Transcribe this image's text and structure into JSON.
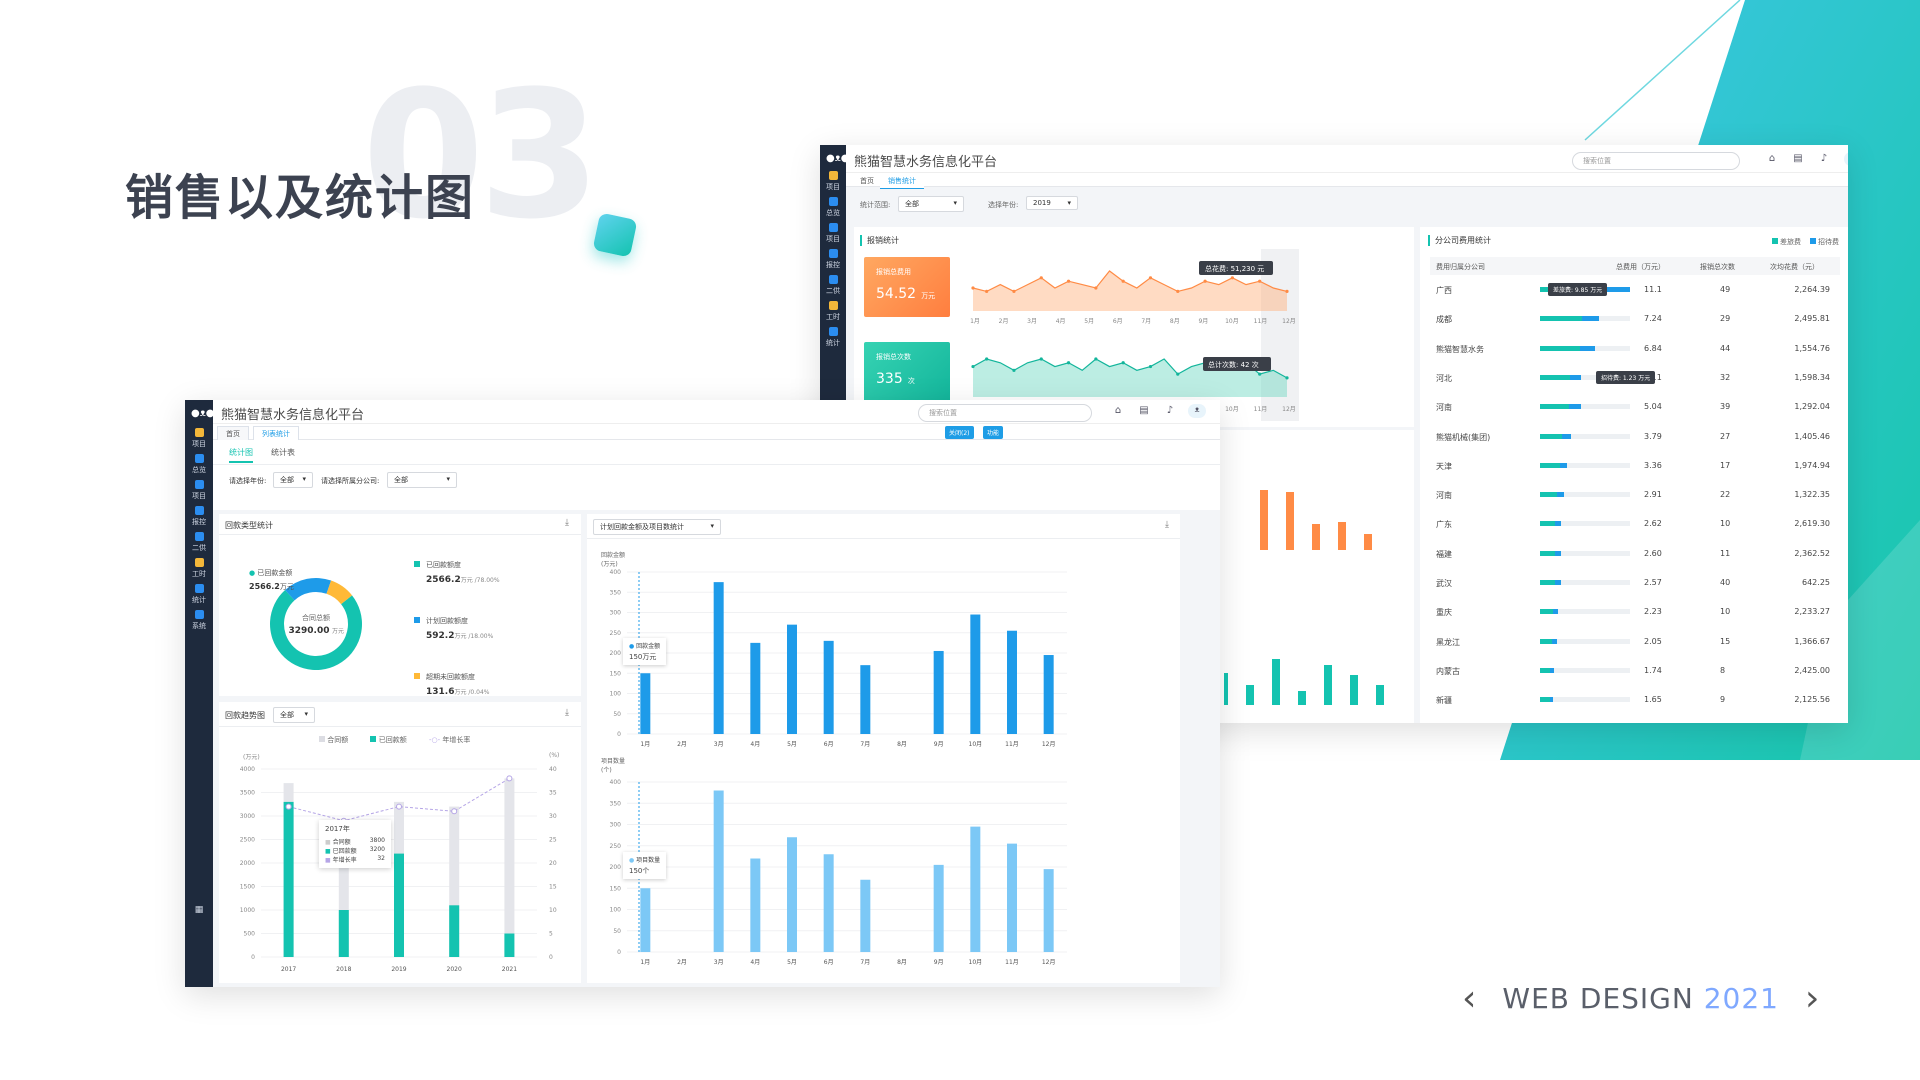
{
  "slide": {
    "title": "销售以及统计图",
    "number": "03",
    "footer_label": "WEB DESIGN",
    "footer_year": "2021",
    "prev_icon": "chevron-left-icon",
    "next_icon": "chevron-right-icon",
    "accent": "#14c3b0"
  },
  "back_window": {
    "app_title": "熊猫智慧水务信息化平台",
    "search_placeholder": "搜索位置",
    "tabs": [
      "首页",
      "销售统计"
    ],
    "filter": {
      "range_label": "统计范围:",
      "range_value": "全部",
      "year_label": "选择年份:",
      "year_value": "2019"
    },
    "sidebar": [
      "项目",
      "总览",
      "项目",
      "报控",
      "二供",
      "工时",
      "统计"
    ],
    "report": {
      "title": "报销统计",
      "cost_card": {
        "label": "报销总费用",
        "value": "54.52",
        "unit": "万元"
      },
      "count_card": {
        "label": "报销总次数",
        "value": "335",
        "unit": "次"
      },
      "cost_tooltip": "总花费: 51,230 元",
      "count_tooltip": "总计次数: 42 次",
      "months": [
        "1月",
        "2月",
        "3月",
        "4月",
        "5月",
        "6月",
        "7月",
        "8月",
        "9月",
        "10月",
        "11月",
        "12月"
      ]
    },
    "branch": {
      "title": "分公司费用统计",
      "legend_a": "差旅费",
      "legend_b": "招待费",
      "columns": [
        "费用归属分公司",
        "总费用（万元）",
        "报销总次数",
        "次均花费（元）"
      ],
      "tooltip_a": "差旅费: 9.85 万元",
      "tooltip_b": "招待费: 1.23 万元",
      "rows": [
        {
          "name": "广西",
          "total": "11.1",
          "count": "49",
          "avg": "2,264.39"
        },
        {
          "name": "成都",
          "total": "7.24",
          "count": "29",
          "avg": "2,495.81"
        },
        {
          "name": "熊猫智慧水务",
          "total": "6.84",
          "count": "44",
          "avg": "1,554.76"
        },
        {
          "name": "河北",
          "total": "5.11",
          "count": "32",
          "avg": "1,598.34"
        },
        {
          "name": "河南",
          "total": "5.04",
          "count": "39",
          "avg": "1,292.04"
        },
        {
          "name": "熊猫机械(集团)",
          "total": "3.79",
          "count": "27",
          "avg": "1,405.46"
        },
        {
          "name": "天津",
          "total": "3.36",
          "count": "17",
          "avg": "1,974.94"
        },
        {
          "name": "河南",
          "total": "2.91",
          "count": "22",
          "avg": "1,322.35"
        },
        {
          "name": "广东",
          "total": "2.62",
          "count": "10",
          "avg": "2,619.30"
        },
        {
          "name": "福建",
          "total": "2.60",
          "count": "11",
          "avg": "2,362.52"
        },
        {
          "name": "武汉",
          "total": "2.57",
          "count": "40",
          "avg": "642.25"
        },
        {
          "name": "重庆",
          "total": "2.23",
          "count": "10",
          "avg": "2,233.27"
        },
        {
          "name": "黑龙江",
          "total": "2.05",
          "count": "15",
          "avg": "1,366.67"
        },
        {
          "name": "内蒙古",
          "total": "1.74",
          "count": "8",
          "avg": "2,425.00"
        },
        {
          "name": "新疆",
          "total": "1.65",
          "count": "9",
          "avg": "2,125.56"
        }
      ]
    }
  },
  "front_window": {
    "app_title": "熊猫智慧水务信息化平台",
    "search_placeholder": "搜索位置",
    "tabs": [
      "首页",
      "列表统计"
    ],
    "buttons": {
      "close": "关闭(2)",
      "more": "功能"
    },
    "sidebar": [
      "项目",
      "总览",
      "项目",
      "报控",
      "二供",
      "工时",
      "统计",
      "系统"
    ],
    "view_tabs": [
      "统计图",
      "统计表"
    ],
    "filters": {
      "year_label": "请选择年份:",
      "year_value": "全部",
      "company_label": "请选择所属分公司:",
      "company_value": "全部"
    },
    "donut": {
      "title": "回款类型统计",
      "center_label": "合同总额",
      "center_value": "3290.00",
      "center_unit": "万元",
      "callout_label": "已回款金额",
      "callout_value": "2566.2",
      "callout_unit": "万元",
      "legend": [
        {
          "label": "已回款额度",
          "value": "2566.2",
          "suffix": "万元 /78.00%",
          "color": "#14c3b0"
        },
        {
          "label": "计划回款额度",
          "value": "592.2",
          "suffix": "万元 /18.00%",
          "color": "#1e9be9"
        },
        {
          "label": "超期未回款额度",
          "value": "131.6",
          "suffix": "万元 /0.04%",
          "color": "#ffb937"
        }
      ]
    },
    "trend": {
      "title": "回款趋势图",
      "select": "全部",
      "legend": [
        "合同额",
        "已回款额",
        "年增长率"
      ],
      "yleft_unit": "(万元)",
      "yright_unit": "(%)",
      "tooltip": {
        "year": "2017年",
        "rows": [
          [
            "合同额",
            "3800"
          ],
          [
            "已回款额",
            "3200"
          ],
          [
            "年增长率",
            "32"
          ]
        ]
      }
    },
    "plan": {
      "select": "计划回款金额及项目数统计",
      "top_unit": "回款金额\n(万元)",
      "top_tooltip_label": "回款金额",
      "top_tooltip_value": "150万元",
      "bottom_unit": "项目数量\n(个)",
      "bottom_tooltip_label": "项目数量",
      "bottom_tooltip_value": "150个"
    }
  },
  "chart_data": [
    {
      "type": "area",
      "title": "报销总费用",
      "categories": [
        "1月",
        "2月",
        "3月",
        "4月",
        "5月",
        "6月",
        "7月",
        "8月",
        "9月",
        "10月",
        "11月",
        "12月"
      ],
      "values": [
        10,
        9,
        11,
        9,
        11,
        13,
        10,
        12,
        11,
        10,
        15,
        12,
        10,
        13,
        11,
        9,
        10,
        12,
        11,
        13,
        11,
        12,
        10,
        9
      ]
    },
    {
      "type": "area",
      "title": "报销总次数",
      "categories": [
        "1月",
        "2月",
        "3月",
        "4月",
        "5月",
        "6月",
        "7月",
        "8月",
        "9月",
        "10月",
        "11月",
        "12月"
      ],
      "values": [
        14,
        16,
        15,
        13,
        15,
        16,
        14,
        15,
        13,
        16,
        14,
        15,
        13,
        14,
        16,
        12,
        14,
        15,
        13,
        14,
        15,
        12,
        13,
        11
      ]
    },
    {
      "type": "bar",
      "title": "回款金额",
      "categories": [
        "1月",
        "2月",
        "3月",
        "4月",
        "5月",
        "6月",
        "7月",
        "8月",
        "9月",
        "10月",
        "11月",
        "12月"
      ],
      "values": [
        150,
        0,
        375,
        225,
        270,
        230,
        170,
        0,
        205,
        295,
        255,
        195
      ],
      "ylim": [
        0,
        400
      ]
    },
    {
      "type": "bar",
      "title": "项目数量",
      "categories": [
        "1月",
        "2月",
        "3月",
        "4月",
        "5月",
        "6月",
        "7月",
        "8月",
        "9月",
        "10月",
        "11月",
        "12月"
      ],
      "values": [
        150,
        0,
        380,
        220,
        270,
        230,
        170,
        0,
        205,
        295,
        255,
        195
      ],
      "ylim": [
        0,
        400
      ]
    },
    {
      "type": "bar",
      "title": "回款趋势图",
      "categories": [
        "2017",
        "2018",
        "2019",
        "2020",
        "2021"
      ],
      "series": [
        {
          "name": "合同额",
          "values": [
            3700,
            2600,
            3300,
            3200,
            3800
          ]
        },
        {
          "name": "已回款额",
          "values": [
            3300,
            1000,
            2200,
            1100,
            500
          ]
        },
        {
          "name": "年增长率",
          "values": [
            32,
            29,
            32,
            31,
            38
          ]
        }
      ],
      "ylim": [
        0,
        4000
      ]
    },
    {
      "type": "pie",
      "title": "回款类型统计",
      "categories": [
        "已回款额度",
        "计划回款额度",
        "超期未回款额度"
      ],
      "values": [
        2566.2,
        592.2,
        131.6
      ]
    }
  ]
}
